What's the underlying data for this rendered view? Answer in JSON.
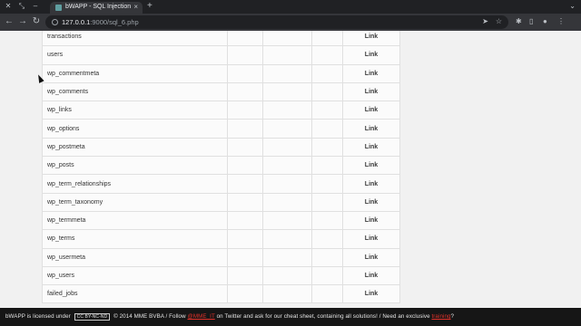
{
  "browser": {
    "tab_title": "bWAPP - SQL Injection",
    "tab_close": "×",
    "new_tab": "+",
    "url_host": "127.0.0.1",
    "url_rest": ":9000/sql_6.php"
  },
  "table": {
    "rows": [
      {
        "name": "transactions",
        "link": "Link"
      },
      {
        "name": "users",
        "link": "Link"
      },
      {
        "name": "wp_commentmeta",
        "link": "Link"
      },
      {
        "name": "wp_comments",
        "link": "Link"
      },
      {
        "name": "wp_links",
        "link": "Link"
      },
      {
        "name": "wp_options",
        "link": "Link"
      },
      {
        "name": "wp_postmeta",
        "link": "Link"
      },
      {
        "name": "wp_posts",
        "link": "Link"
      },
      {
        "name": "wp_term_relationships",
        "link": "Link"
      },
      {
        "name": "wp_term_taxonomy",
        "link": "Link"
      },
      {
        "name": "wp_termmeta",
        "link": "Link"
      },
      {
        "name": "wp_terms",
        "link": "Link"
      },
      {
        "name": "wp_usermeta",
        "link": "Link"
      },
      {
        "name": "wp_users",
        "link": "Link"
      },
      {
        "name": "failed_jobs",
        "link": "Link"
      }
    ]
  },
  "footer": {
    "part1": "bWAPP is licensed under",
    "cc_badge": "CC BY-NC-ND",
    "part2": "© 2014 MME BVBA / Follow",
    "twitter_handle": "@MME_IT",
    "part3": "on Twitter and ask for our cheat sheet, containing all solutions! / Need an exclusive",
    "training_link": "training",
    "part4": "?"
  },
  "colors": {
    "footer_bg": "#161616",
    "link_red": "#e0322b",
    "chrome_dark": "#202124"
  }
}
